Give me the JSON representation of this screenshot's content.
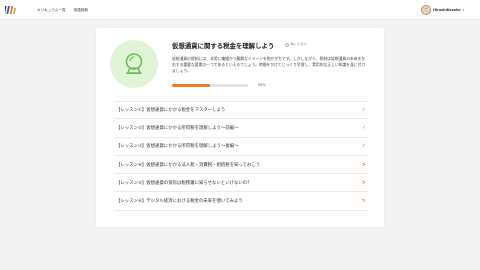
{
  "header": {
    "nav": [
      {
        "label": "カリキュラム一覧"
      },
      {
        "label": "用語辞典"
      }
    ],
    "user": {
      "name": "HiroshiKosaka",
      "caret": "▾"
    }
  },
  "course": {
    "title": "仮想通貨に関する税金を理解しよう",
    "lesson_count_label": "6レッスン",
    "description": "仮想通貨の税制には、非常に複雑かつ難解なイメージを抱かがちです。しかしながら、税制は仮想通貨の未来を左右する重要な要素の一つであるといえるでしょう。時間をかけてじっくり学習し、実用的な正しい知識を身に付けましょう。",
    "progress_percent": 50,
    "progress_label": "50%"
  },
  "lessons": [
    {
      "label": "【レッスン①】仮想通貨にかかる税金をマスターしよう",
      "status": "done",
      "status_icon": "✓"
    },
    {
      "label": "【レッスン②】仮想通貨にかかる所得税を理解しよう〜前編〜",
      "status": "done",
      "status_icon": "✓"
    },
    {
      "label": "【レッスン③】仮想通貨にかかる所得税を理解しよう〜後編〜",
      "status": "done",
      "status_icon": "✓"
    },
    {
      "label": "【レッスン④】仮想通貨にかかる法人税・消費税・相続税を知っておこう",
      "status": "todo",
      "status_icon": ">"
    },
    {
      "label": "【レッスン⑤】仮想通貨の保有は税務署に知らせないといけないの？",
      "status": "todo",
      "status_icon": ">"
    },
    {
      "label": "【レッスン⑥】デジタル経済における税金の未来を覗いてみよう",
      "status": "todo",
      "status_icon": ">"
    }
  ],
  "colors": {
    "accent": "#f07a22",
    "done": "#3fb86b",
    "icon_bg": "#e1f3d6",
    "icon_stroke": "#6bbf5a"
  },
  "icons": {
    "logo": "brand-logo-icon",
    "course": "crystal-ball-icon",
    "lessons_meta": "clock-icon"
  }
}
